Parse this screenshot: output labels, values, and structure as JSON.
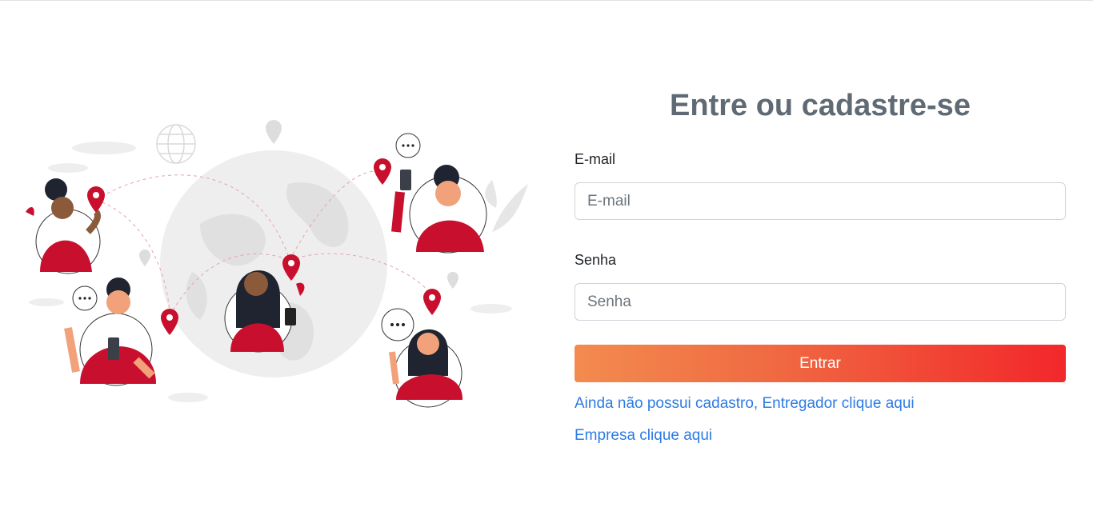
{
  "form": {
    "title": "Entre ou cadastre-se",
    "email_label": "E-mail",
    "email_placeholder": "E-mail",
    "email_value": "",
    "password_label": "Senha",
    "password_placeholder": "Senha",
    "password_value": "",
    "submit_label": "Entrar",
    "signup_courier_link": "Ainda não possui cadastro, Entregador clique aqui",
    "signup_company_link": "Empresa clique aqui"
  },
  "illustration": {
    "icons": [
      "globe-icon",
      "location-pin-icon",
      "speech-bubble-icon",
      "person-avatar-icon",
      "smartphone-icon"
    ]
  },
  "colors": {
    "title": "#5f6a74",
    "link": "#2d7be5",
    "button_gradient_start": "#f38b4f",
    "button_gradient_end": "#f2272a",
    "accent_red": "#c8102e"
  }
}
